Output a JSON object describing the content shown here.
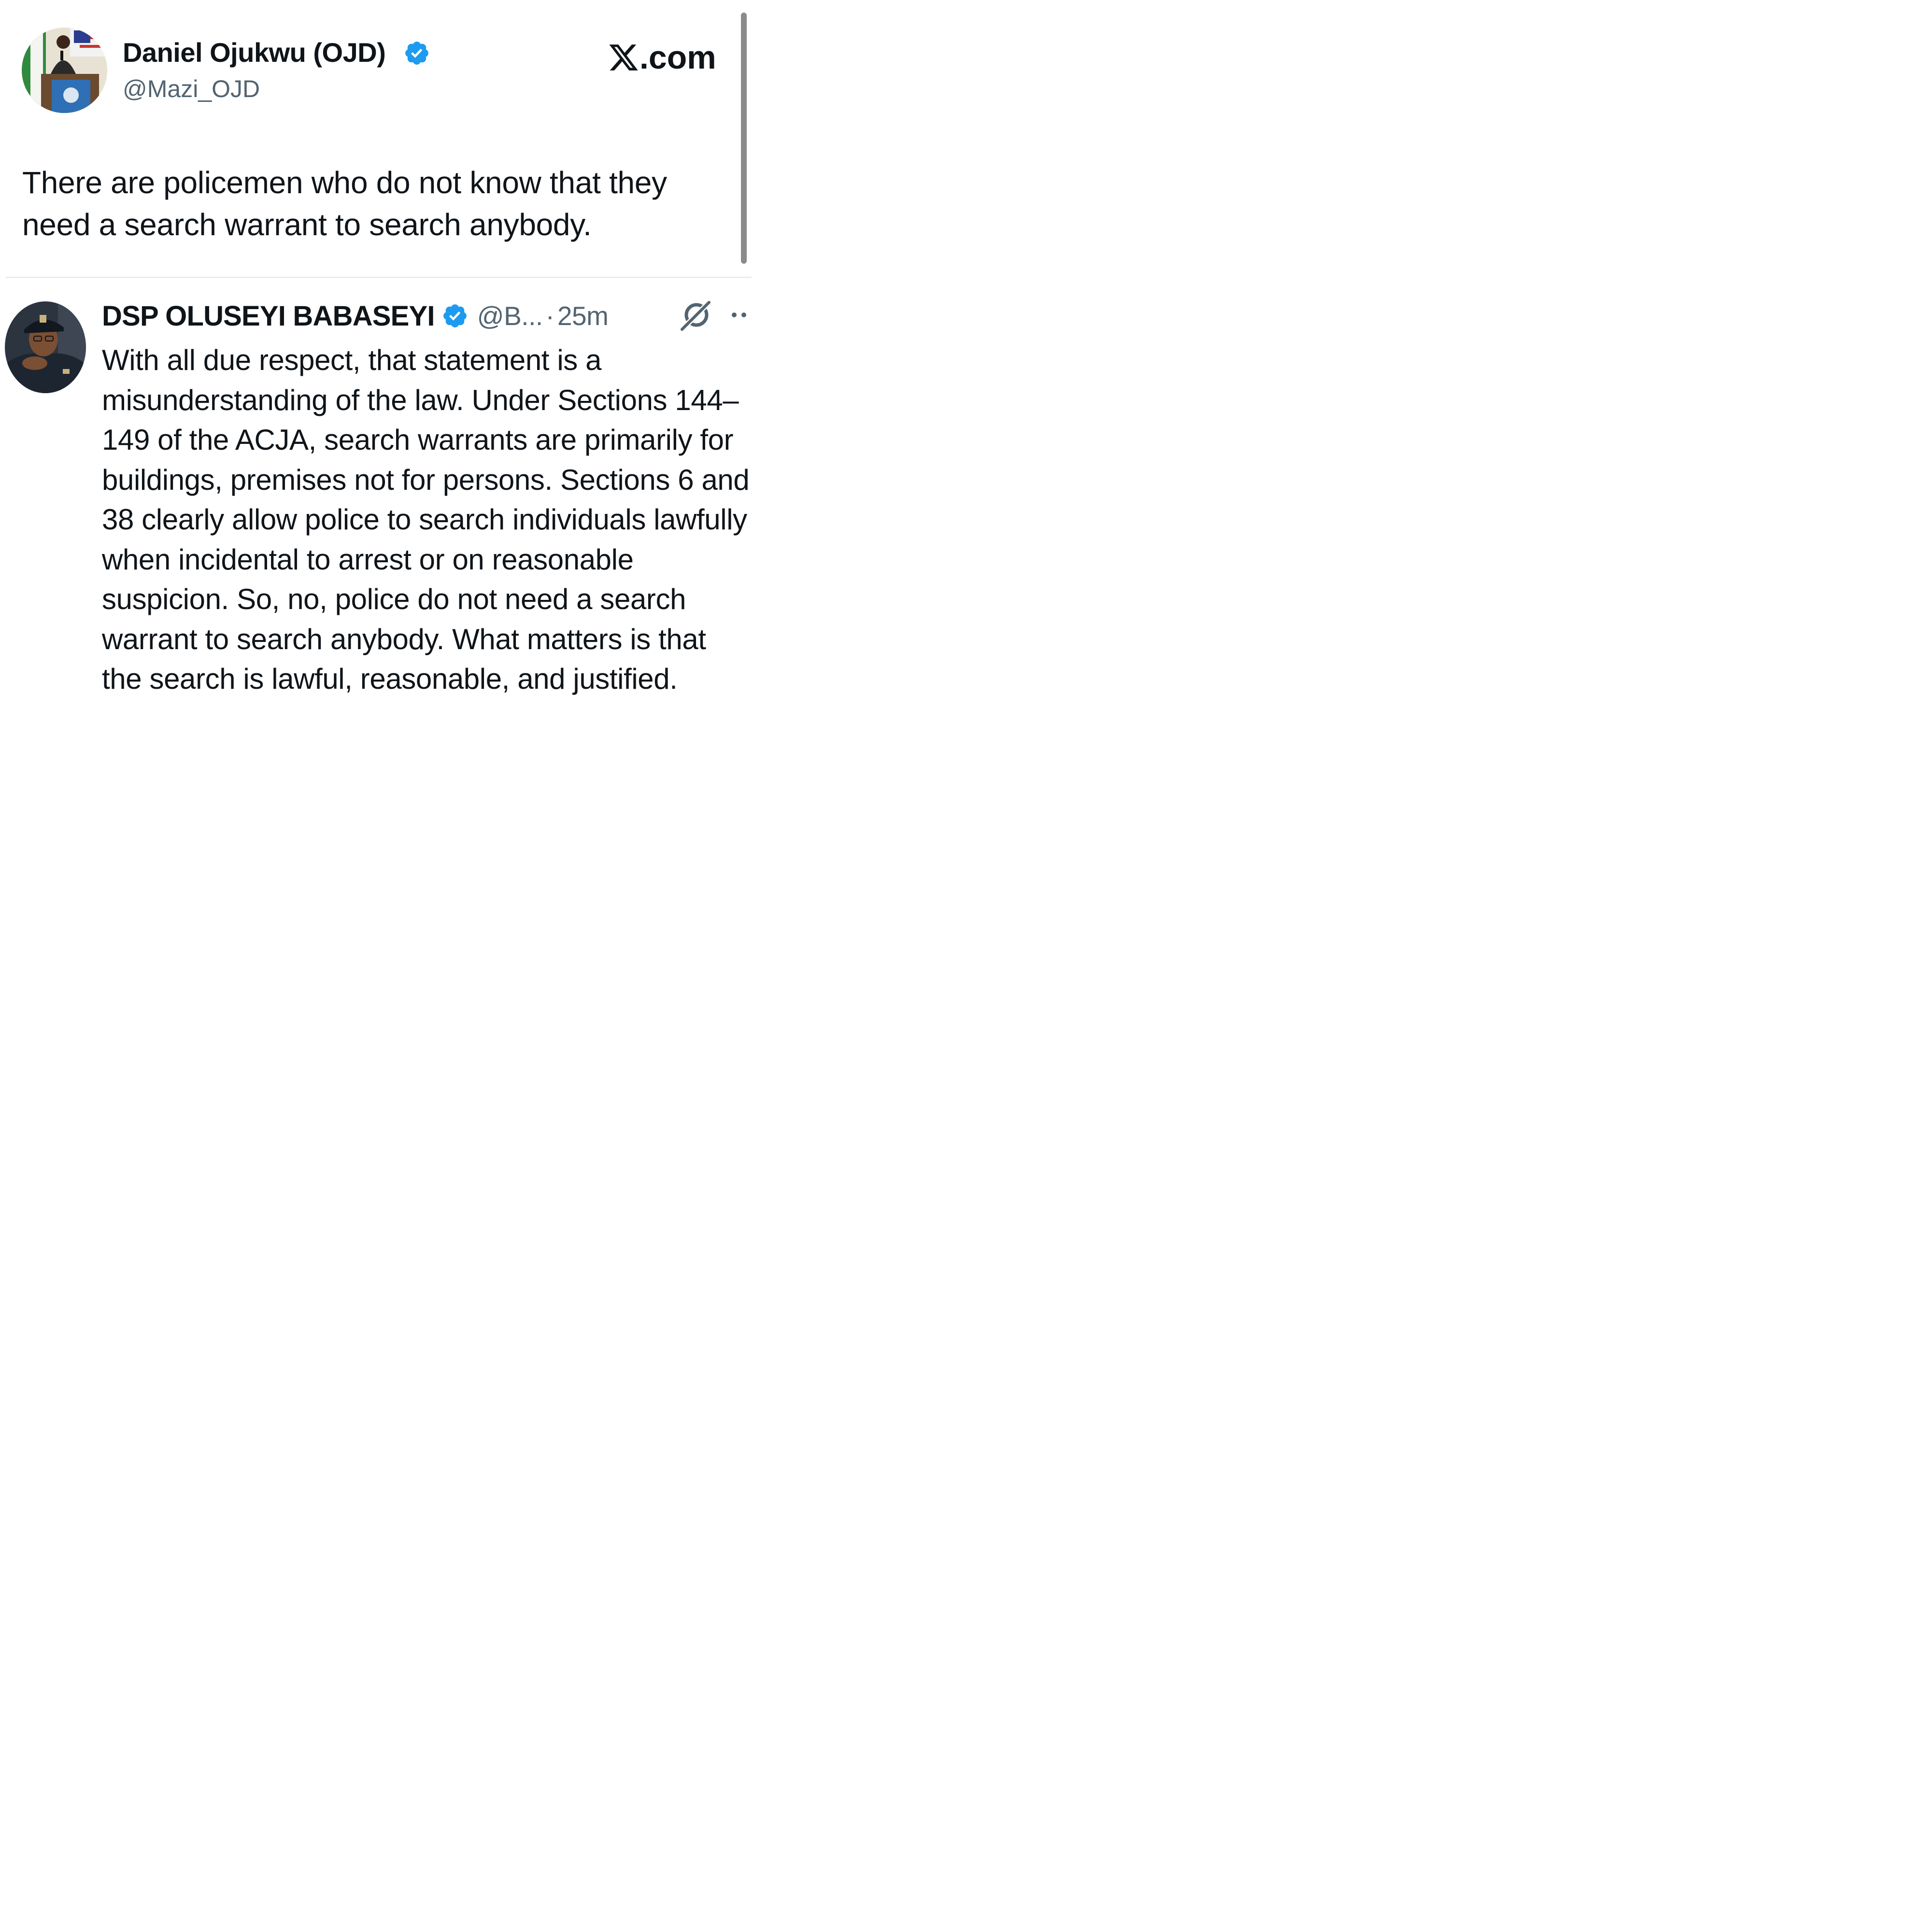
{
  "original_tweet": {
    "author_name": "Daniel Ojukwu (OJD)",
    "author_handle": "@Mazi_OJD",
    "verified_icon": "verified-badge-icon",
    "text": "There are policemen who do not know that they need a search warrant to search anybody."
  },
  "brand": {
    "text": ".com",
    "icon": "x-logo-icon"
  },
  "reply": {
    "author_name": "DSP OLUSEYI BABASEYI",
    "author_handle": "@B...",
    "separator": "·",
    "time": "25m",
    "verified_icon": "verified-badge-icon",
    "grok_icon": "grok-icon",
    "more_icon": "more-icon",
    "text": "With all due respect, that statement is a misunderstanding of the law. Under Sections 144–149 of the ACJA, search warrants are primarily for buildings, premises not for persons. Sections 6 and 38 clearly allow police to search individuals lawfully when incidental to arrest or on reasonable suspicion. So, no, police do not need a search warrant to search anybody. What matters is that the search is lawful, reasonable, and justified."
  },
  "colors": {
    "text_primary": "#0f1419",
    "text_secondary": "#536471",
    "verified_blue": "#1d9bf0",
    "divider": "#e1e4e8",
    "background": "#ffffff"
  }
}
